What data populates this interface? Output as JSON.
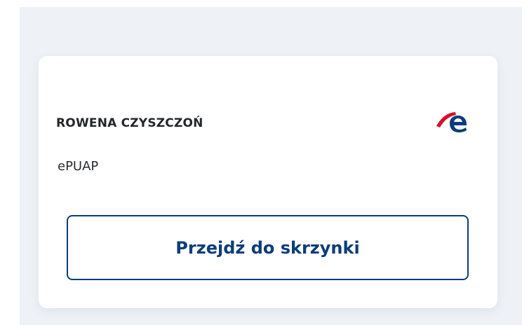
{
  "card": {
    "owner_name": "ROWENA CZYSZCZOŃ",
    "service_name": "ePUAP",
    "logo_icon": "epuap-e-logo-icon",
    "button_label": "Przejdź do skrzynki"
  },
  "colors": {
    "page_background": "#eef2f7",
    "card_background": "#ffffff",
    "primary": "#0b3d7a",
    "logo_red": "#d8102a",
    "logo_blue": "#0b3d7a",
    "text": "#23262b"
  }
}
